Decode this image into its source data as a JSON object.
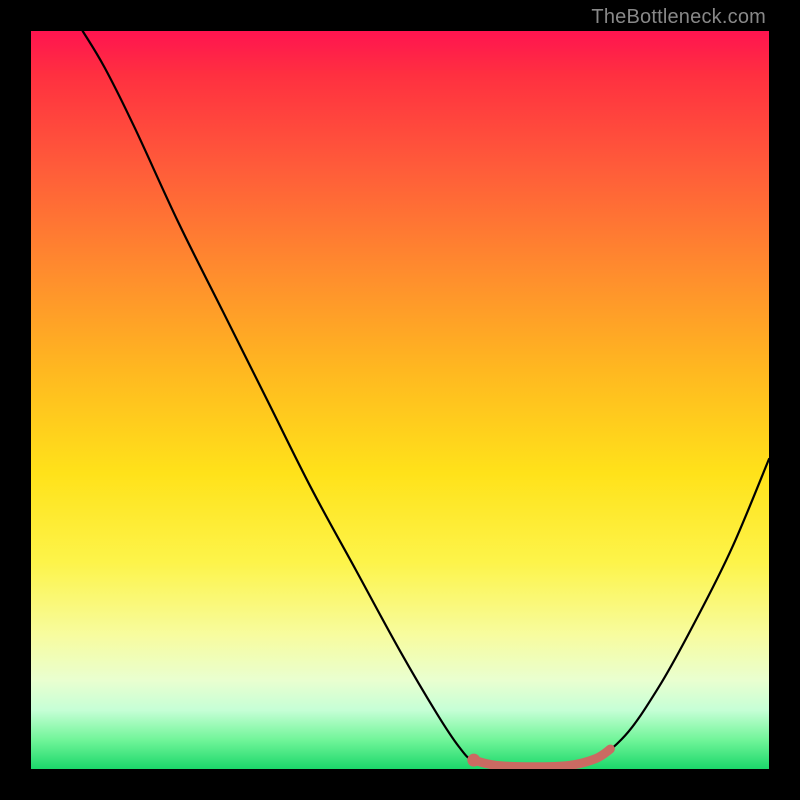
{
  "watermark": "TheBottleneck.com",
  "chart_data": {
    "type": "line",
    "title": "",
    "xlabel": "",
    "ylabel": "",
    "xlim": [
      0,
      100
    ],
    "ylim": [
      0,
      100
    ],
    "gradient_stops": [
      {
        "pos": 0,
        "color": "#ff1450"
      },
      {
        "pos": 6,
        "color": "#ff3040"
      },
      {
        "pos": 18,
        "color": "#ff5a3a"
      },
      {
        "pos": 32,
        "color": "#ff8a2e"
      },
      {
        "pos": 46,
        "color": "#ffb820"
      },
      {
        "pos": 60,
        "color": "#ffe21a"
      },
      {
        "pos": 72,
        "color": "#fdf44a"
      },
      {
        "pos": 82,
        "color": "#f7fca0"
      },
      {
        "pos": 88,
        "color": "#e9ffd0"
      },
      {
        "pos": 92,
        "color": "#c6ffd6"
      },
      {
        "pos": 96,
        "color": "#72f59a"
      },
      {
        "pos": 100,
        "color": "#1bd86a"
      }
    ],
    "series": [
      {
        "name": "bottleneck-curve",
        "color": "#000000",
        "points": [
          {
            "x": 7.0,
            "y": 100.0
          },
          {
            "x": 10.0,
            "y": 95.0
          },
          {
            "x": 14.0,
            "y": 87.0
          },
          {
            "x": 20.0,
            "y": 74.0
          },
          {
            "x": 26.0,
            "y": 62.0
          },
          {
            "x": 32.0,
            "y": 50.0
          },
          {
            "x": 38.0,
            "y": 38.0
          },
          {
            "x": 44.0,
            "y": 27.0
          },
          {
            "x": 50.0,
            "y": 16.0
          },
          {
            "x": 55.0,
            "y": 7.5
          },
          {
            "x": 58.0,
            "y": 3.0
          },
          {
            "x": 60.0,
            "y": 1.0
          },
          {
            "x": 63.0,
            "y": 0.2
          },
          {
            "x": 68.0,
            "y": 0.0
          },
          {
            "x": 75.0,
            "y": 0.8
          },
          {
            "x": 80.0,
            "y": 4.0
          },
          {
            "x": 85.0,
            "y": 11.0
          },
          {
            "x": 90.0,
            "y": 20.0
          },
          {
            "x": 95.0,
            "y": 30.0
          },
          {
            "x": 100.0,
            "y": 42.0
          }
        ]
      },
      {
        "name": "highlight-segment",
        "color": "#cb6a62",
        "points": [
          {
            "x": 60.0,
            "y": 1.2
          },
          {
            "x": 63.0,
            "y": 0.5
          },
          {
            "x": 68.0,
            "y": 0.3
          },
          {
            "x": 73.0,
            "y": 0.5
          },
          {
            "x": 76.5,
            "y": 1.4
          },
          {
            "x": 78.5,
            "y": 2.7
          }
        ]
      }
    ],
    "marker": {
      "x": 60.0,
      "y": 1.2,
      "color": "#cb6a62"
    }
  }
}
